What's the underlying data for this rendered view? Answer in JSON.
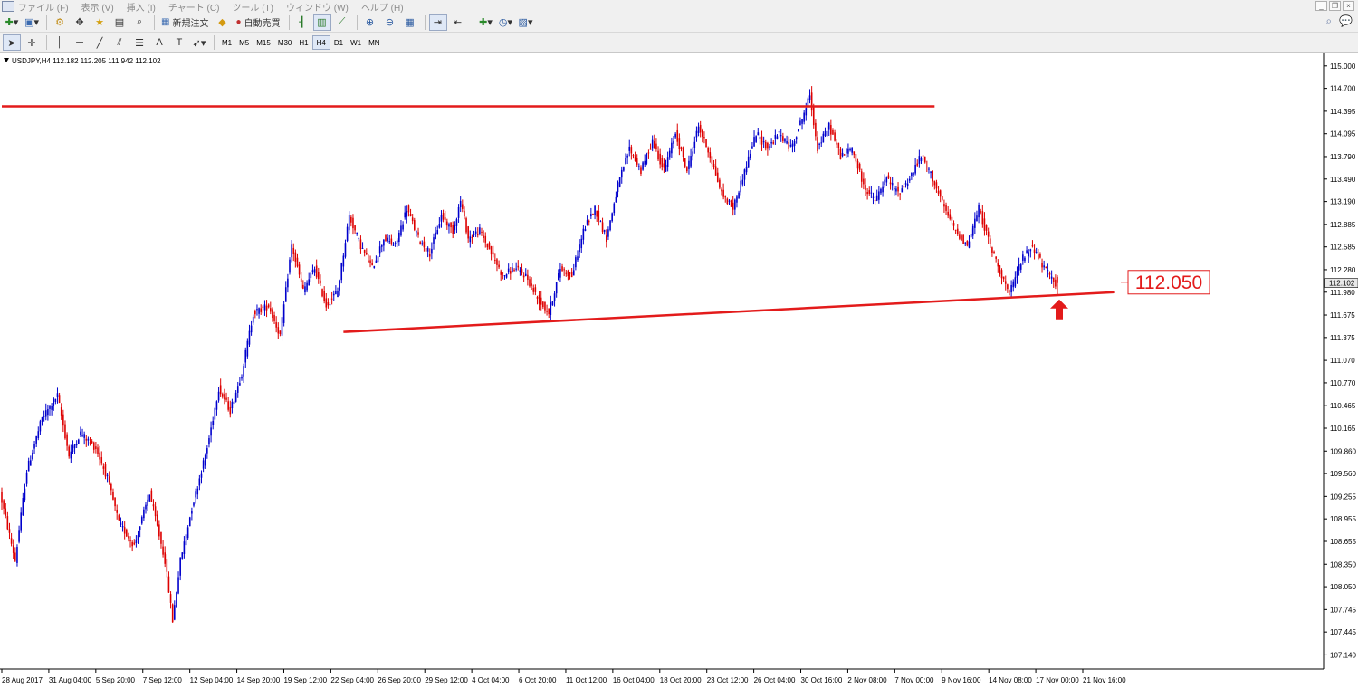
{
  "menu": [
    "ファイル (F)",
    "表示 (V)",
    "挿入 (I)",
    "チャート (C)",
    "ツール (T)",
    "ウィンドウ (W)",
    "ヘルプ (H)"
  ],
  "toolbar": {
    "new_order": "新規注文",
    "auto_trade": "自動売買",
    "timeframes": [
      "M1",
      "M5",
      "M15",
      "M30",
      "H1",
      "H4",
      "D1",
      "W1",
      "MN"
    ],
    "active_timeframe": "H4"
  },
  "chart_header": "USDJPY,H4  112.182 112.205 111.942 112.102",
  "colors": {
    "bull": "#0000cc",
    "bear": "#dd0000",
    "line": "#e31b1b"
  },
  "chart_data": {
    "type": "candlestick",
    "symbol": "USDJPY",
    "timeframe": "H4",
    "ohlc": {
      "open": 112.182,
      "high": 112.205,
      "low": 111.942,
      "close": 112.102
    },
    "current_price": "112.102",
    "ylim": [
      107.0,
      115.07
    ],
    "y_ticks": [
      "115.000",
      "114.700",
      "114.395",
      "114.095",
      "113.790",
      "113.490",
      "113.190",
      "112.885",
      "112.585",
      "112.280",
      "111.980",
      "111.675",
      "111.375",
      "111.070",
      "110.770",
      "110.465",
      "110.165",
      "109.860",
      "109.560",
      "109.255",
      "108.955",
      "108.655",
      "108.350",
      "108.050",
      "107.745",
      "107.445",
      "107.140"
    ],
    "x_ticks": [
      "28 Aug 2017",
      "31 Aug 04:00",
      "5 Sep 20:00",
      "7 Sep 12:00",
      "12 Sep 04:00",
      "14 Sep 20:00",
      "19 Sep 12:00",
      "22 Sep 04:00",
      "26 Sep 20:00",
      "29 Sep 12:00",
      "4 Oct 04:00",
      "6 Oct 20:00",
      "11 Oct 12:00",
      "16 Oct 04:00",
      "18 Oct 20:00",
      "23 Oct 12:00",
      "26 Oct 04:00",
      "30 Oct 16:00",
      "2 Nov 08:00",
      "7 Nov 00:00",
      "9 Nov 16:00",
      "14 Nov 08:00",
      "17 Nov 00:00",
      "21 Nov 16:00"
    ],
    "anchors": [
      [
        0,
        109.3
      ],
      [
        8,
        108.4
      ],
      [
        14,
        109.6
      ],
      [
        22,
        110.3
      ],
      [
        30,
        110.6
      ],
      [
        36,
        109.8
      ],
      [
        42,
        110.1
      ],
      [
        50,
        109.9
      ],
      [
        56,
        109.5
      ],
      [
        62,
        108.9
      ],
      [
        70,
        108.6
      ],
      [
        78,
        109.3
      ],
      [
        86,
        108.4
      ],
      [
        90,
        107.6
      ],
      [
        94,
        108.4
      ],
      [
        100,
        109.1
      ],
      [
        108,
        109.9
      ],
      [
        114,
        110.7
      ],
      [
        120,
        110.4
      ],
      [
        126,
        110.9
      ],
      [
        132,
        111.7
      ],
      [
        140,
        111.8
      ],
      [
        146,
        111.4
      ],
      [
        152,
        112.6
      ],
      [
        158,
        112.0
      ],
      [
        164,
        112.3
      ],
      [
        170,
        111.8
      ],
      [
        176,
        112.0
      ],
      [
        182,
        113.0
      ],
      [
        188,
        112.6
      ],
      [
        194,
        112.3
      ],
      [
        200,
        112.7
      ],
      [
        206,
        112.6
      ],
      [
        212,
        113.1
      ],
      [
        218,
        112.7
      ],
      [
        224,
        112.5
      ],
      [
        230,
        113.0
      ],
      [
        236,
        112.8
      ],
      [
        240,
        113.2
      ],
      [
        244,
        112.7
      ],
      [
        250,
        112.8
      ],
      [
        256,
        112.5
      ],
      [
        262,
        112.2
      ],
      [
        268,
        112.3
      ],
      [
        274,
        112.2
      ],
      [
        280,
        111.9
      ],
      [
        286,
        111.7
      ],
      [
        292,
        112.3
      ],
      [
        298,
        112.2
      ],
      [
        304,
        112.8
      ],
      [
        310,
        113.1
      ],
      [
        316,
        112.7
      ],
      [
        322,
        113.4
      ],
      [
        328,
        113.9
      ],
      [
        334,
        113.6
      ],
      [
        340,
        114.0
      ],
      [
        346,
        113.6
      ],
      [
        352,
        114.1
      ],
      [
        358,
        113.6
      ],
      [
        364,
        114.2
      ],
      [
        370,
        113.8
      ],
      [
        376,
        113.3
      ],
      [
        382,
        113.1
      ],
      [
        388,
        113.6
      ],
      [
        394,
        114.1
      ],
      [
        400,
        113.9
      ],
      [
        406,
        114.1
      ],
      [
        412,
        113.9
      ],
      [
        418,
        114.3
      ],
      [
        422,
        114.6
      ],
      [
        426,
        113.9
      ],
      [
        432,
        114.2
      ],
      [
        438,
        113.8
      ],
      [
        444,
        113.9
      ],
      [
        450,
        113.4
      ],
      [
        456,
        113.2
      ],
      [
        462,
        113.5
      ],
      [
        468,
        113.3
      ],
      [
        474,
        113.5
      ],
      [
        480,
        113.8
      ],
      [
        486,
        113.5
      ],
      [
        492,
        113.1
      ],
      [
        498,
        112.8
      ],
      [
        504,
        112.6
      ],
      [
        510,
        113.1
      ],
      [
        516,
        112.6
      ],
      [
        522,
        112.2
      ],
      [
        526,
        111.95
      ],
      [
        532,
        112.4
      ],
      [
        538,
        112.6
      ],
      [
        544,
        112.3
      ],
      [
        550,
        112.1
      ]
    ],
    "resistance_line": {
      "price": 114.46,
      "from_bar": 0,
      "to_bar": 486
    },
    "support_line": {
      "from": [
        178,
        111.45
      ],
      "to": [
        580,
        111.98
      ]
    },
    "annotation": {
      "label": "112.050"
    }
  }
}
